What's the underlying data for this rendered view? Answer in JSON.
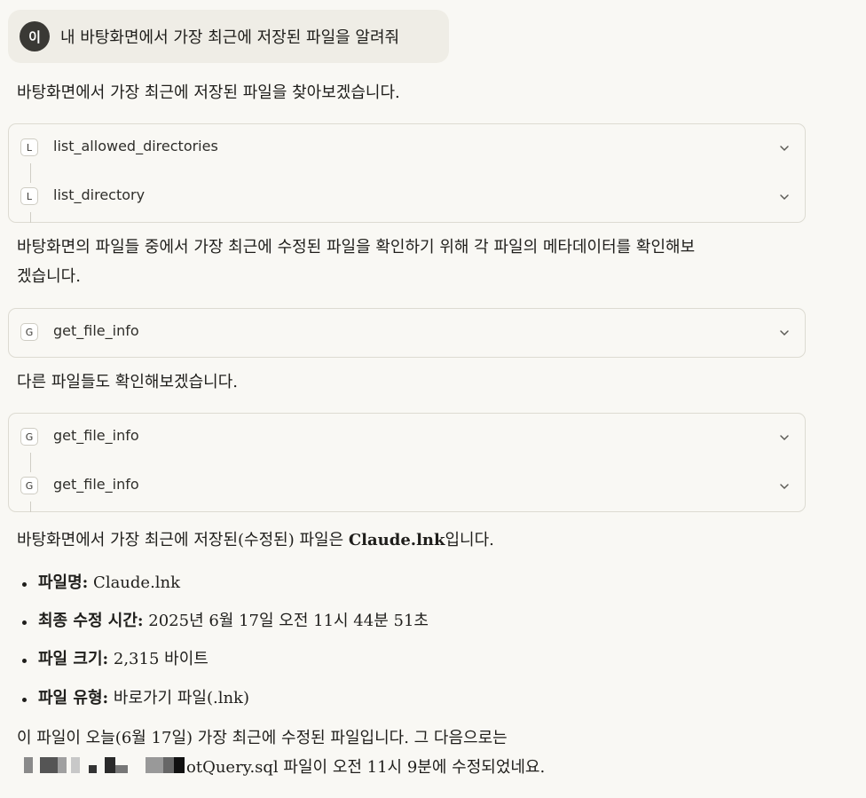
{
  "user_message": {
    "avatar_initial": "이",
    "text": "내 바탕화면에서 가장 최근에 저장된 파일을 알려줘"
  },
  "assistant": {
    "para1": "바탕화면에서 가장 최근에 저장된 파일을 찾아보겠습니다.",
    "tool_group_1": [
      {
        "letter": "L",
        "name": "list_allowed_directories"
      },
      {
        "letter": "L",
        "name": "list_directory"
      }
    ],
    "para2_line1": "바탕화면의 파일들 중에서 가장 최근에 수정된 파일을 확인하기 위해 각 파일의 메타데이터를 확인해보",
    "para2_line2": "겠습니다.",
    "tool_group_2": [
      {
        "letter": "G",
        "name": "get_file_info"
      }
    ],
    "para3": "다른 파일들도 확인해보겠습니다.",
    "tool_group_3": [
      {
        "letter": "G",
        "name": "get_file_info"
      },
      {
        "letter": "G",
        "name": "get_file_info"
      }
    ],
    "summary_pre": "바탕화면에서 가장 최근에 저장된(수정된) 파일은 ",
    "summary_bold": "Claude.lnk",
    "summary_post": "입니다.",
    "facts": [
      {
        "label": "파일명:",
        "value": " Claude.lnk"
      },
      {
        "label": "최종 수정 시간:",
        "value": " 2025년 6월 17일 오전 11시 44분 51초"
      },
      {
        "label": "파일 크기:",
        "value": " 2,315 바이트"
      },
      {
        "label": "파일 유형:",
        "value": " 바로가기 파일(.lnk)"
      }
    ],
    "closing_line1": "이 파일이 오늘(6월 17일) 가장 최근에 수정된 파일입니다. 그 다음으로는",
    "closing_line2_visible": "otQuery.sql 파일이 오전 11시 9분에 수정되었네요."
  }
}
